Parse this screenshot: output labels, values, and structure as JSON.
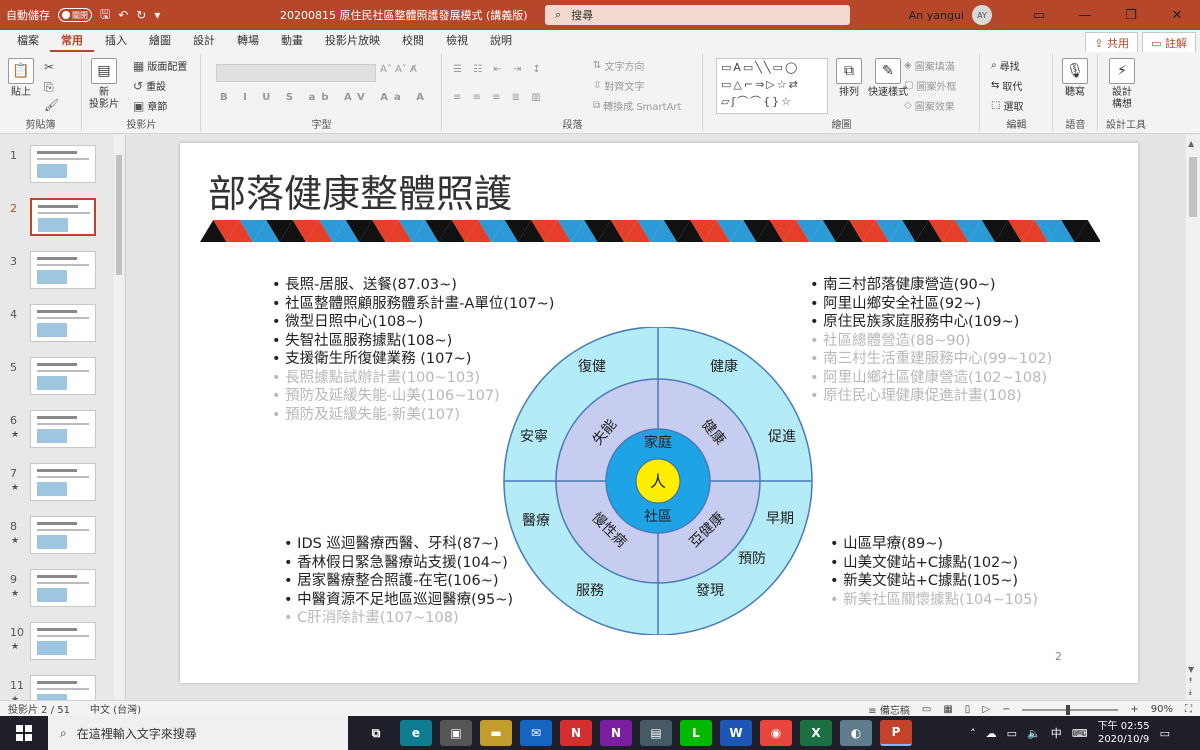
{
  "titlebar": {
    "autosave_label": "自動儲存",
    "autosave_state": "關閉",
    "doc_title": "20200815 原住民社區整體照護發展模式 (講義版)",
    "search_placeholder": "搜尋",
    "user_name": "An yangui",
    "user_initials": "AY"
  },
  "tabs": [
    "檔案",
    "常用",
    "插入",
    "繪圖",
    "設計",
    "轉場",
    "動畫",
    "投影片放映",
    "校閱",
    "檢視",
    "說明"
  ],
  "active_tab": "常用",
  "share_label": "共用",
  "comment_label": "註解",
  "ribbon": {
    "clipboard": {
      "label": "剪貼簿",
      "paste": "貼上"
    },
    "slides": {
      "label": "投影片",
      "new_slide": "新\n投影片",
      "layout": "版面配置",
      "reset": "重設",
      "section": "章節"
    },
    "font": {
      "label": "字型"
    },
    "paragraph": {
      "label": "段落",
      "text_direction": "文字方向",
      "align_text": "對齊文字",
      "smartart": "轉換成 SmartArt"
    },
    "drawing": {
      "label": "繪圖",
      "arrange": "排列",
      "quick_styles": "快速樣式",
      "shape_fill": "圖案填滿",
      "shape_outline": "圖案外框",
      "shape_effects": "圖案效果"
    },
    "editing": {
      "label": "編輯",
      "find": "尋找",
      "replace": "取代",
      "select": "選取"
    },
    "voice": {
      "label": "語音",
      "dictate": "聽寫"
    },
    "designer": {
      "label": "設計工具",
      "design_ideas": "設計\n構想"
    }
  },
  "thumbnails": [
    {
      "num": "1",
      "star": ""
    },
    {
      "num": "2",
      "star": "",
      "active": true
    },
    {
      "num": "3",
      "star": ""
    },
    {
      "num": "4",
      "star": ""
    },
    {
      "num": "5",
      "star": ""
    },
    {
      "num": "6",
      "star": "★"
    },
    {
      "num": "7",
      "star": "★"
    },
    {
      "num": "8",
      "star": "★"
    },
    {
      "num": "9",
      "star": "★"
    },
    {
      "num": "10",
      "star": "★"
    },
    {
      "num": "11",
      "star": "★"
    }
  ],
  "slide": {
    "title": "部落健康整體照護",
    "page_number": "2",
    "top_left": [
      {
        "text": "長照-居服、送餐(87.03~)",
        "dim": false
      },
      {
        "text": "社區整體照顧服務體系計畫-A單位(107~)",
        "dim": false
      },
      {
        "text": "微型日照中心(108~)",
        "dim": false
      },
      {
        "text": "失智社區服務據點(108~)",
        "dim": false
      },
      {
        "text": "支援衛生所復健業務 (107~)",
        "dim": false
      },
      {
        "text": "長照據點試辦計畫(100~103)",
        "dim": true
      },
      {
        "text": "預防及延緩失能-山美(106~107)",
        "dim": true
      },
      {
        "text": "預防及延緩失能-新美(107)",
        "dim": true
      }
    ],
    "top_right": [
      {
        "text": "南三村部落健康營造(90~)",
        "dim": false
      },
      {
        "text": "阿里山鄉安全社區(92~)",
        "dim": false
      },
      {
        "text": "原住民族家庭服務中心(109~)",
        "dim": false
      },
      {
        "text": "社區總體營造(88~90)",
        "dim": true
      },
      {
        "text": "南三村生活重建服務中心(99~102)",
        "dim": true
      },
      {
        "text": "阿里山鄉社區健康營造(102~108)",
        "dim": true
      },
      {
        "text": "原住民心理健康促進計畫(108)",
        "dim": true
      }
    ],
    "bottom_left": [
      {
        "text": "IDS 巡迴醫療西醫、牙科(87~)",
        "dim": false
      },
      {
        "text": "香林假日緊急醫療站支援(104~)",
        "dim": false
      },
      {
        "text": "居家醫療整合照護-在宅(106~)",
        "dim": false
      },
      {
        "text": "中醫資源不足地區巡迴醫療(95~)",
        "dim": false
      },
      {
        "text": "C肝消除計畫(107~108)",
        "dim": true
      }
    ],
    "bottom_right": [
      {
        "text": "山區早療(89~)",
        "dim": false
      },
      {
        "text": "山美文健站+C據點(102~)",
        "dim": false
      },
      {
        "text": "新美文健站+C據點(105~)",
        "dim": false
      },
      {
        "text": "新美社區關懷據點(104~105)",
        "dim": true
      }
    ],
    "wheel": {
      "center": "人",
      "inner": [
        "家庭",
        "社區"
      ],
      "middle": [
        "失能",
        "健康",
        "慢性病",
        "亞健康"
      ],
      "outer": [
        "復健",
        "健康",
        "安寧",
        "促進",
        "醫療",
        "早期",
        "預防",
        "服務",
        "發現"
      ],
      "colors": {
        "outer": "#b3ecf7",
        "middle": "#c7cdf1",
        "inner": "#1ea3e6",
        "center": "#ffee00"
      }
    },
    "banner_colors": [
      "#e53e2a",
      "#111111",
      "#2b9ad6"
    ]
  },
  "statusbar": {
    "slide_info": "投影片 2 / 51",
    "language": "中文 (台灣)",
    "notes": "備忘稿",
    "zoom": "90%"
  },
  "taskbar": {
    "search_placeholder": "在這裡輸入文字來搜尋",
    "time": "下午 02:55",
    "date": "2020/10/9",
    "ime": "中"
  }
}
